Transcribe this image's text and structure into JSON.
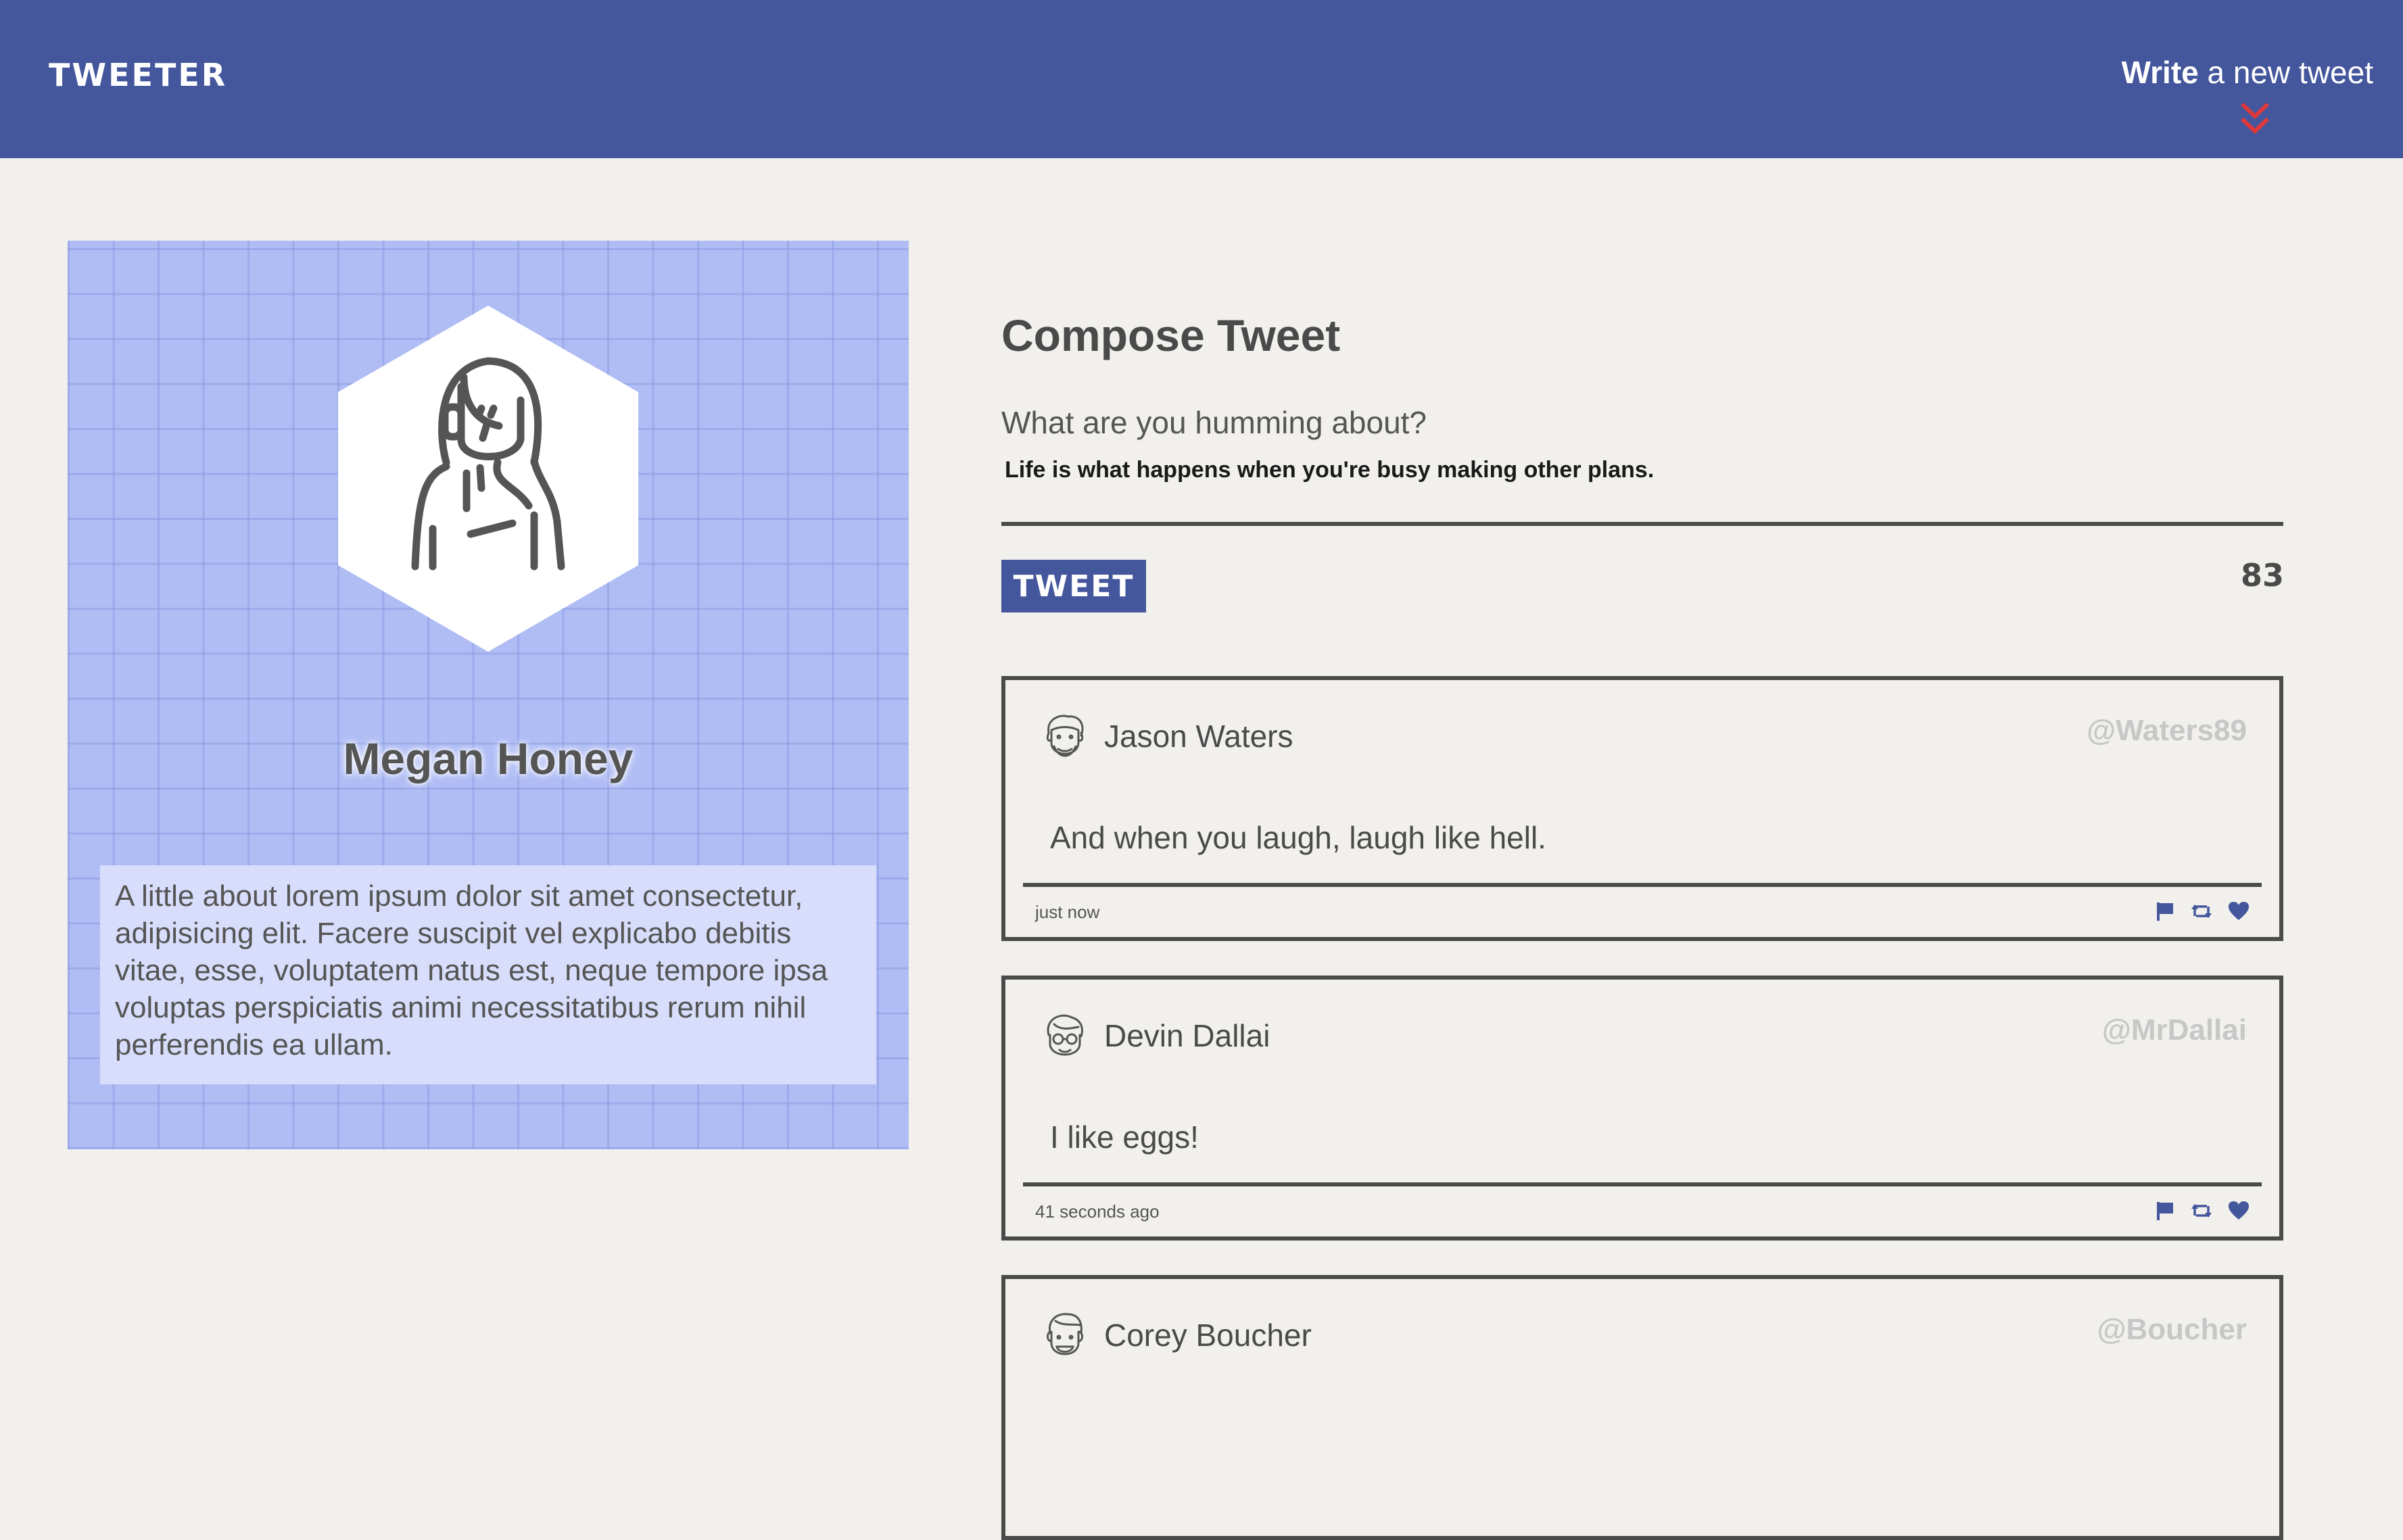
{
  "header": {
    "brand": "TWEETER",
    "write_bold": "Write",
    "write_rest": " a new tweet"
  },
  "profile": {
    "name": "Megan Honey",
    "bio": "A little about lorem ipsum dolor sit amet consectetur, adipisicing elit. Facere suscipit vel explicabo debitis vitae, esse, voluptatem natus est, neque tempore ipsa voluptas perspiciatis animi necessitatibus rerum nihil perferendis ea ullam."
  },
  "compose": {
    "title": "Compose Tweet",
    "label": "What are you humming about?",
    "text": "Life is what happens when you're busy making other plans.",
    "button_label": "TWEET",
    "counter": "83"
  },
  "tweets": [
    {
      "author": "Jason Waters",
      "handle": "@Waters89",
      "body": "And when you laugh, laugh like hell.",
      "time": "just now",
      "avatar_icon": "bearded-man-avatar-icon"
    },
    {
      "author": "Devin Dallai",
      "handle": "@MrDallai",
      "body": "I like eggs!",
      "time": "41 seconds ago",
      "avatar_icon": "glasses-man-avatar-icon"
    },
    {
      "author": "Corey Boucher",
      "handle": "@Boucher",
      "body": "",
      "time": "",
      "avatar_icon": "smiling-man-avatar-icon"
    }
  ],
  "colors": {
    "header_bg": "#44569c",
    "page_bg": "#f2f0ec",
    "profile_bg": "#b0bdf5",
    "accent_chevron": "#e0383b",
    "handle_text": "#c7c7c7"
  },
  "icons": [
    "double-chevron-down-icon",
    "woman-avatar-icon",
    "flag-icon",
    "retweet-icon",
    "heart-icon"
  ]
}
